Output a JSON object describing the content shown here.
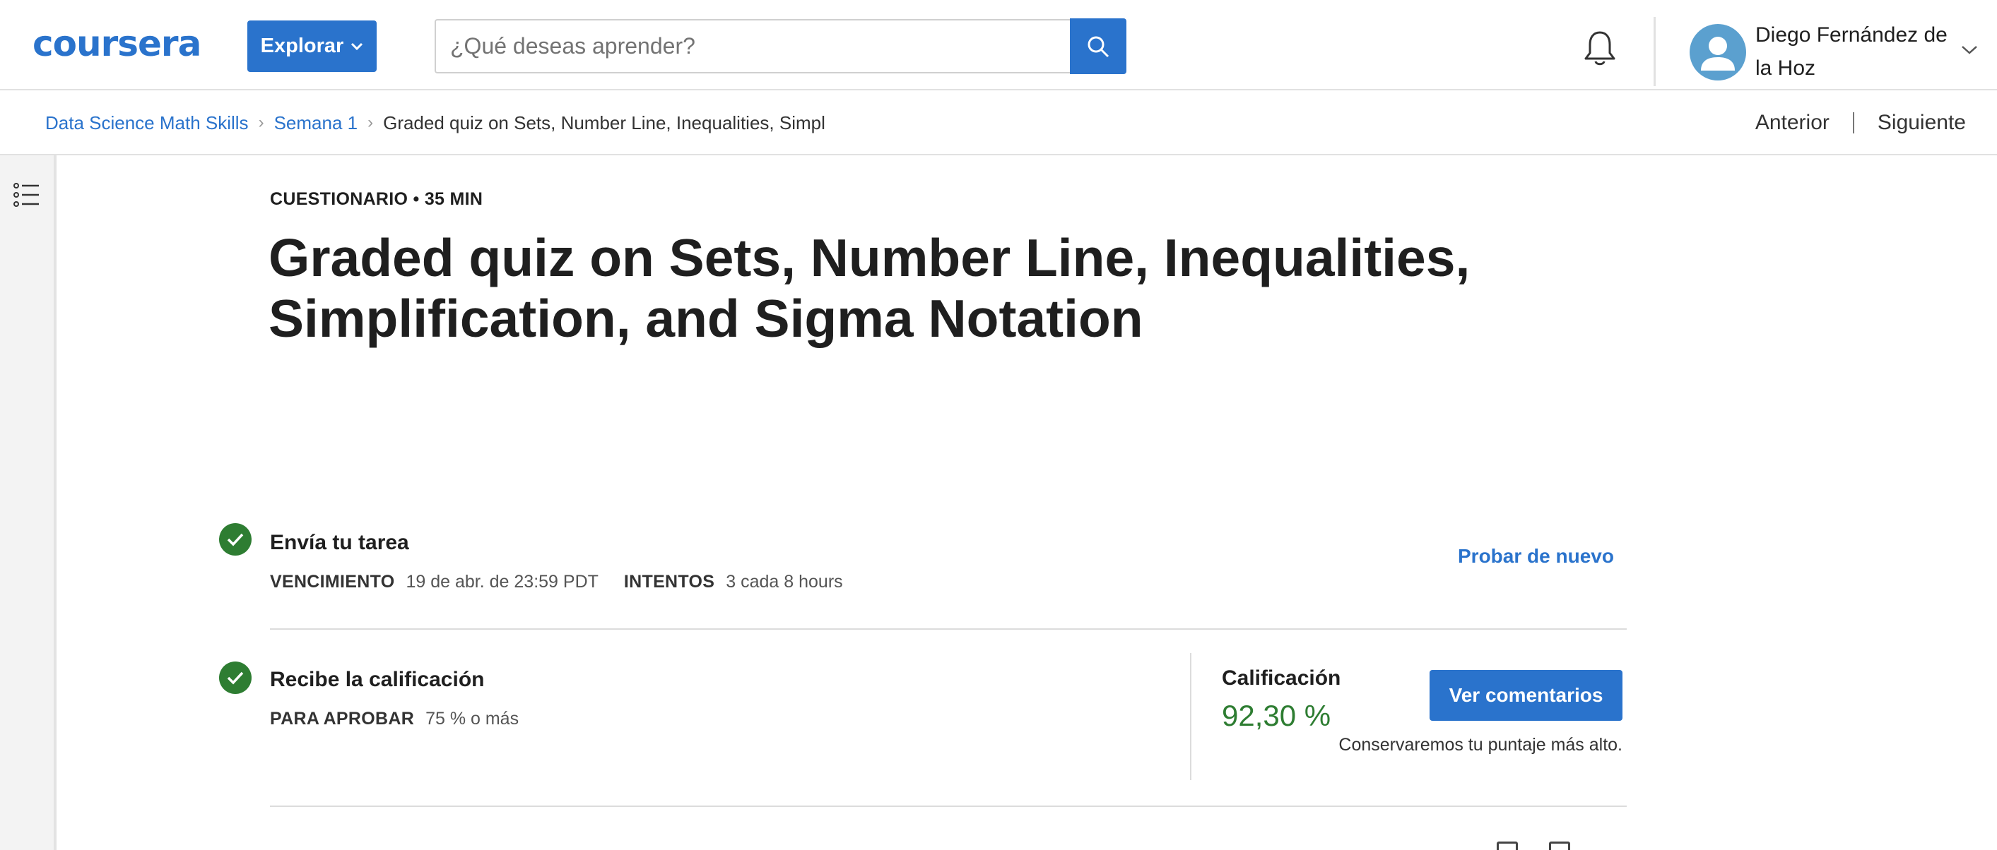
{
  "header": {
    "logo_text": "coursera",
    "explore_label": "Explorar",
    "search_placeholder": "¿Qué deseas aprender?",
    "user_name_line1": "Diego Fernández de",
    "user_name_line2": "la Hoz",
    "icons": [
      "search-icon",
      "bell-icon",
      "user-avatar-icon",
      "chevron-down-icon"
    ]
  },
  "breadcrumb": {
    "items": [
      "Data Science Math Skills",
      "Semana 1"
    ],
    "current": "Graded quiz on Sets, Number Line, Inequalities, Simpl"
  },
  "pager": {
    "previous": "Anterior",
    "next": "Siguiente"
  },
  "quiz": {
    "meta": "CUESTIONARIO • 35 MIN",
    "title": "Graded quiz on Sets, Number Line, Inequalities, Simplification, and Sigma Notation"
  },
  "submit": {
    "title": "Envía tu tarea",
    "due_label": "VENCIMIENTO",
    "due_value": "19 de abr. de 23:59 PDT",
    "attempts_label": "INTENTOS",
    "attempts_value": "3 cada 8 hours",
    "retry_label": "Probar de nuevo"
  },
  "grade": {
    "title": "Recibe la calificación",
    "pass_label": "PARA APROBAR",
    "pass_value": "75 % o más",
    "grade_label": "Calificación",
    "grade_value": "92,30 %",
    "feedback_label": "Ver comentarios",
    "keep_note": "Conservaremos tu puntaje más alto."
  },
  "colors": {
    "brand": "#2a73cc",
    "success": "#2e7d32"
  }
}
